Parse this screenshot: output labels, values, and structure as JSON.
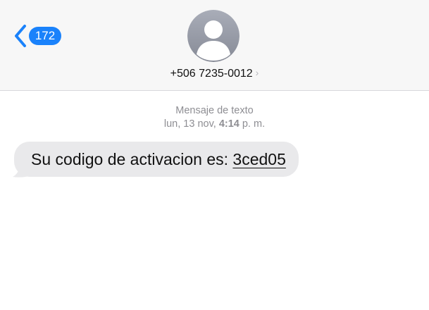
{
  "header": {
    "back_count": "172",
    "contact": "+506 7235-0012",
    "contact_chevron": "›"
  },
  "thread": {
    "service_label": "Mensaje de texto",
    "date_prefix": "lun, 13 nov, ",
    "time": "4:14",
    "time_suffix": " p. m."
  },
  "message": {
    "text_prefix": "Su codigo de activacion es: ",
    "code": "3ced05"
  },
  "colors": {
    "accent": "#1a82fb",
    "bubble": "#e9e9eb",
    "header_bg": "#f7f7f7",
    "meta_text": "#8e8e93",
    "avatar_bg": "#a2a6b2"
  },
  "icons": {
    "back": "chevron-left-icon",
    "avatar": "person-silhouette-icon",
    "contact_details": "chevron-right-icon"
  }
}
